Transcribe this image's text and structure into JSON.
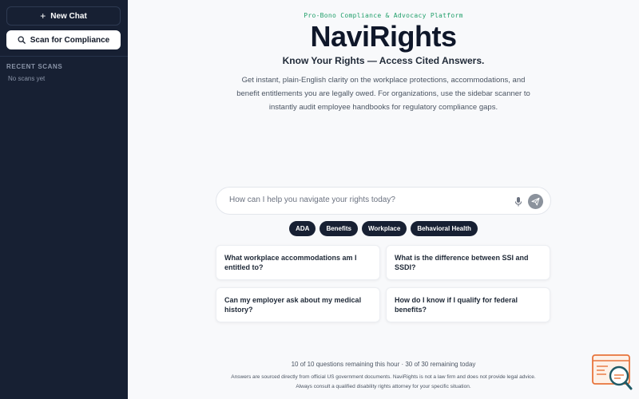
{
  "sidebar": {
    "new_chat_label": "New Chat",
    "scan_label": "Scan for Compliance",
    "recent_title": "RECENT SCANS",
    "recent_empty": "No scans yet"
  },
  "hero": {
    "tagline": "Pro-Bono Compliance & Advocacy Platform",
    "brand": "NaviRights",
    "subtitle": "Know Your Rights — Access Cited Answers.",
    "description": "Get instant, plain-English clarity on the workplace protections, accommodations, and benefit entitlements you are legally owed. For organizations, use the sidebar scanner to instantly audit employee handbooks for regulatory compliance gaps."
  },
  "search": {
    "placeholder": "How can I help you navigate your rights today?",
    "value": ""
  },
  "chips": [
    "ADA",
    "Benefits",
    "Workplace",
    "Behavioral Health"
  ],
  "suggestions": [
    "What workplace accommodations am I entitled to?",
    "What is the difference between SSI and SSDI?",
    "Can my employer ask about my medical history?",
    "How do I know if I qualify for federal benefits?"
  ],
  "footer": {
    "quota": "10 of 10 questions remaining this hour · 30 of 30 remaining today",
    "disclaimer_line1": "Answers are sourced directly from official US government documents. NaviRights is not a law firm and does not provide legal advice.",
    "disclaimer_line2": "Always consult a qualified disability rights attorney for your specific situation."
  },
  "colors": {
    "sidebar_bg": "#172033",
    "accent_green": "#22a06b",
    "chip_bg": "#172033",
    "send_button": "#8b929c",
    "logo_orange": "#e8743b",
    "logo_teal": "#1f5a66"
  },
  "icons": [
    "plus-icon",
    "search-icon",
    "mic-icon",
    "send-icon",
    "document-search-icon"
  ]
}
